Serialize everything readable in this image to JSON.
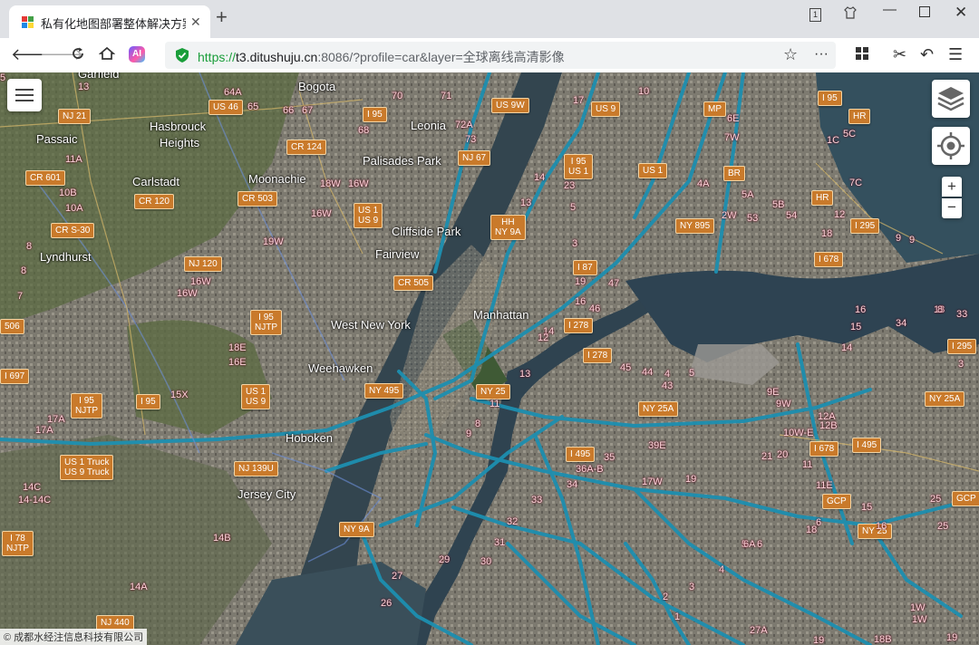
{
  "browser": {
    "tab_title": "私有化地图部署整体解决方案",
    "url_scheme": "https://",
    "url_host": "t3.ditushuju.cn",
    "url_rest": ":8086/?profile=car&layer=全球离线高清影像"
  },
  "map": {
    "places": [
      {
        "name": "Hasbrouck"
      },
      {
        "name": "Heights"
      },
      {
        "name": "Passaic"
      },
      {
        "name": "Carlstadt"
      },
      {
        "name": "Moonachie"
      },
      {
        "name": "Bogota"
      },
      {
        "name": "Leonia"
      },
      {
        "name": "Palisades Park"
      },
      {
        "name": "Cliffside Park"
      },
      {
        "name": "Fairview"
      },
      {
        "name": "Lyndhurst"
      },
      {
        "name": "West New York"
      },
      {
        "name": "Manhattan"
      },
      {
        "name": "Weehawken"
      },
      {
        "name": "Hoboken"
      },
      {
        "name": "Jersey City"
      },
      {
        "name": "Garfield"
      }
    ],
    "shields": [
      {
        "text": "NJ 21"
      },
      {
        "text": "US 46"
      },
      {
        "text": "I 95"
      },
      {
        "text": "US 9W"
      },
      {
        "text": "US 9"
      },
      {
        "text": "I 95"
      },
      {
        "text": "MP"
      },
      {
        "text": "HR"
      },
      {
        "text": "CR 124"
      },
      {
        "text": "NJ 67"
      },
      {
        "text": "I 95\nUS 1"
      },
      {
        "text": "US 1"
      },
      {
        "text": "BR"
      },
      {
        "text": "CR 601"
      },
      {
        "text": "CR 120"
      },
      {
        "text": "CR 503"
      },
      {
        "text": "US 1\nUS 9"
      },
      {
        "text": "HH\nNY 9A"
      },
      {
        "text": "NY 895"
      },
      {
        "text": "HR"
      },
      {
        "text": "I 295"
      },
      {
        "text": "CR S-30"
      },
      {
        "text": "NJ 120"
      },
      {
        "text": "I 87"
      },
      {
        "text": "I 678"
      },
      {
        "text": "CR 505"
      },
      {
        "text": "I 95\nNJTP"
      },
      {
        "text": "I 278"
      },
      {
        "text": "I 278"
      },
      {
        "text": "I 295"
      },
      {
        "text": "I 95\nNJTP"
      },
      {
        "text": "I 95"
      },
      {
        "text": "US 1\nUS 9"
      },
      {
        "text": "NY 495"
      },
      {
        "text": "NY 25"
      },
      {
        "text": "NY 25A"
      },
      {
        "text": "NY 25A"
      },
      {
        "text": "US 1 Truck\nUS 9 Truck"
      },
      {
        "text": "NJ 139U"
      },
      {
        "text": "I 495"
      },
      {
        "text": "I 678"
      },
      {
        "text": "I 495"
      },
      {
        "text": "GCP"
      },
      {
        "text": "GCP"
      },
      {
        "text": "NY 9A"
      },
      {
        "text": "NY 25"
      },
      {
        "text": "I 78\nNJTP"
      },
      {
        "text": "NJ 440"
      },
      {
        "text": "I 697"
      },
      {
        "text": "506"
      }
    ],
    "exits": [
      {
        "t": "13"
      },
      {
        "t": "64A"
      },
      {
        "t": "65"
      },
      {
        "t": "66"
      },
      {
        "t": "67"
      },
      {
        "t": "70"
      },
      {
        "t": "71"
      },
      {
        "t": "68"
      },
      {
        "t": "72A"
      },
      {
        "t": "73"
      },
      {
        "t": "17"
      },
      {
        "t": "10"
      },
      {
        "t": "11A"
      },
      {
        "t": "10B"
      },
      {
        "t": "10A"
      },
      {
        "t": "18W"
      },
      {
        "t": "16W"
      },
      {
        "t": "16W"
      },
      {
        "t": "13"
      },
      {
        "t": "14"
      },
      {
        "t": "23"
      },
      {
        "t": "5"
      },
      {
        "t": "3"
      },
      {
        "t": "19W"
      },
      {
        "t": "16W"
      },
      {
        "t": "16W"
      },
      {
        "t": "8"
      },
      {
        "t": "8"
      },
      {
        "t": "7"
      },
      {
        "t": "19"
      },
      {
        "t": "16"
      },
      {
        "t": "47"
      },
      {
        "t": "46"
      },
      {
        "t": "14"
      },
      {
        "t": "12"
      },
      {
        "t": "18E"
      },
      {
        "t": "16E"
      },
      {
        "t": "15X"
      },
      {
        "t": "45"
      },
      {
        "t": "44"
      },
      {
        "t": "43"
      },
      {
        "t": "4"
      },
      {
        "t": "5"
      },
      {
        "t": "13"
      },
      {
        "t": "17A"
      },
      {
        "t": "17A"
      },
      {
        "t": "11"
      },
      {
        "t": "9"
      },
      {
        "t": "8"
      },
      {
        "t": "39E"
      },
      {
        "t": "35"
      },
      {
        "t": "36A-B"
      },
      {
        "t": "34"
      },
      {
        "t": "17W"
      },
      {
        "t": "19"
      },
      {
        "t": "33"
      },
      {
        "t": "32"
      },
      {
        "t": "31"
      },
      {
        "t": "30"
      },
      {
        "t": "29"
      },
      {
        "t": "27"
      },
      {
        "t": "26"
      },
      {
        "t": "14B"
      },
      {
        "t": "14A"
      },
      {
        "t": "14C"
      },
      {
        "t": "14-14C"
      },
      {
        "t": "6E"
      },
      {
        "t": "7W"
      },
      {
        "t": "4A"
      },
      {
        "t": "5A"
      },
      {
        "t": "5B"
      },
      {
        "t": "53"
      },
      {
        "t": "54"
      },
      {
        "t": "2W"
      },
      {
        "t": "7C"
      },
      {
        "t": "1C"
      },
      {
        "t": "5C"
      },
      {
        "t": "12"
      },
      {
        "t": "18"
      },
      {
        "t": "16"
      },
      {
        "t": "15"
      },
      {
        "t": "34"
      },
      {
        "t": "14"
      },
      {
        "t": "13"
      },
      {
        "t": "9E"
      },
      {
        "t": "9W"
      },
      {
        "t": "10W-E"
      },
      {
        "t": "12A"
      },
      {
        "t": "12B"
      },
      {
        "t": "20"
      },
      {
        "t": "21"
      },
      {
        "t": "11"
      },
      {
        "t": "11E"
      },
      {
        "t": "15"
      },
      {
        "t": "16"
      },
      {
        "t": "25"
      },
      {
        "t": "25"
      },
      {
        "t": "18"
      },
      {
        "t": "6"
      },
      {
        "t": "6"
      },
      {
        "t": "5"
      },
      {
        "t": "4"
      },
      {
        "t": "3"
      },
      {
        "t": "2"
      },
      {
        "t": "1"
      },
      {
        "t": "27A"
      },
      {
        "t": "19"
      },
      {
        "t": "18B"
      },
      {
        "t": "1W"
      },
      {
        "t": "1W"
      },
      {
        "t": "19"
      },
      {
        "t": "9"
      },
      {
        "t": "9"
      },
      {
        "t": "8"
      },
      {
        "t": "33"
      },
      {
        "t": "3"
      },
      {
        "t": "6A"
      },
      {
        "t": "5"
      }
    ]
  },
  "controls": {
    "zoom_in": "+",
    "zoom_out": "−"
  },
  "attribution": "© 成都水经注信息科技有限公司"
}
